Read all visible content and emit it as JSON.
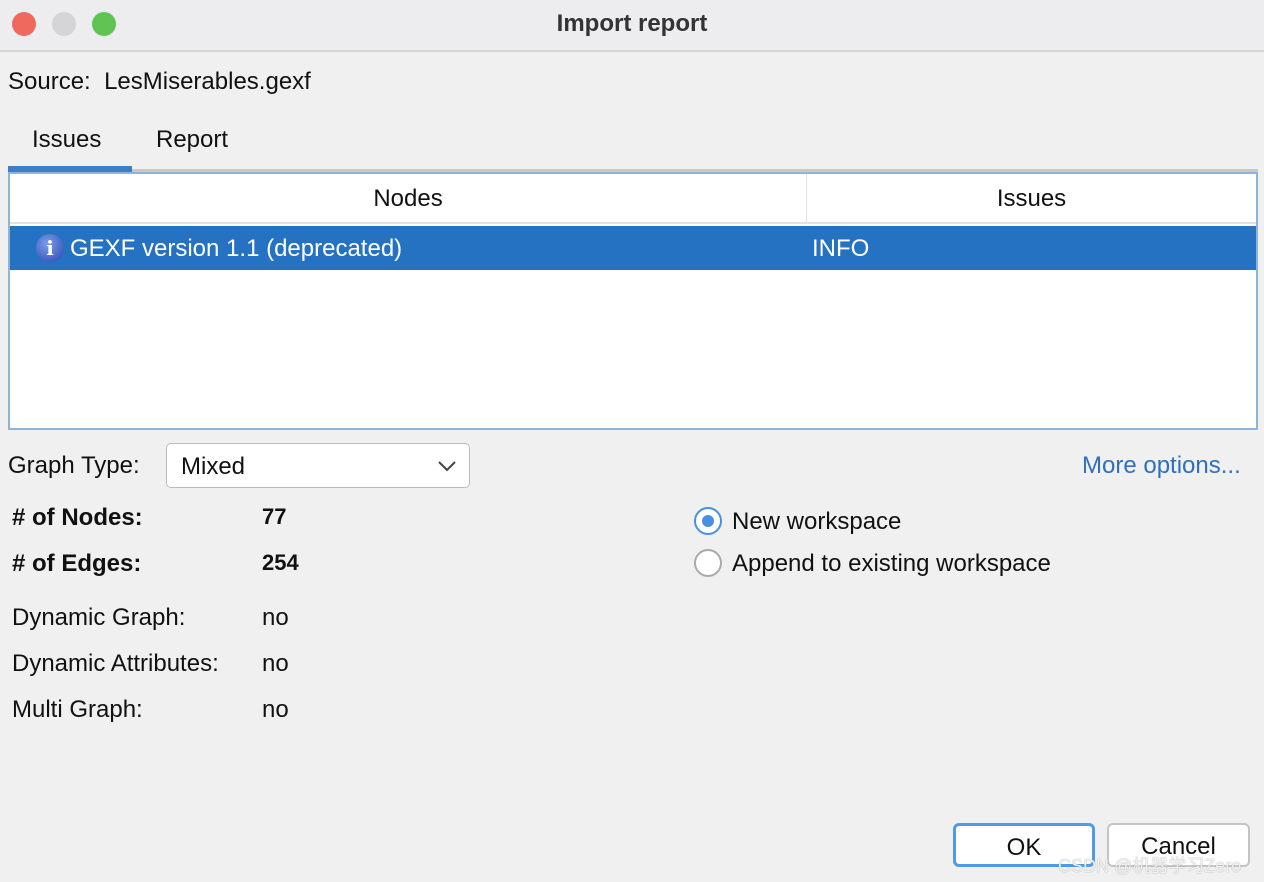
{
  "window": {
    "title": "Import report",
    "colors": {
      "close": "#ee6a5e",
      "minimize": "#d5d5d8",
      "zoom": "#5fc454",
      "accent": "#2572c2"
    }
  },
  "source": {
    "label": "Source:",
    "value": "LesMiserables.gexf"
  },
  "tabs": [
    {
      "label": "Issues",
      "active": true
    },
    {
      "label": "Report",
      "active": false
    }
  ],
  "table": {
    "columns": [
      "Nodes",
      "Issues"
    ],
    "rows": [
      {
        "icon": "info-icon",
        "message": "GEXF version 1.1 (deprecated)",
        "level": "INFO",
        "selected": true
      }
    ]
  },
  "graph_type": {
    "label": "Graph Type:",
    "value": "Mixed"
  },
  "more_options": "More options...",
  "stats": [
    {
      "label": "# of Nodes:",
      "value": "77"
    },
    {
      "label": "# of Edges:",
      "value": "254"
    },
    {
      "label": "Dynamic Graph:",
      "value": "no"
    },
    {
      "label": "Dynamic Attributes:",
      "value": "no"
    },
    {
      "label": "Multi Graph:",
      "value": "no"
    }
  ],
  "workspace": [
    {
      "label": "New workspace",
      "checked": true
    },
    {
      "label": "Append to existing workspace",
      "checked": false
    }
  ],
  "buttons": {
    "ok": "OK",
    "cancel": "Cancel"
  },
  "watermark": "CSDN @机器学习Zero"
}
